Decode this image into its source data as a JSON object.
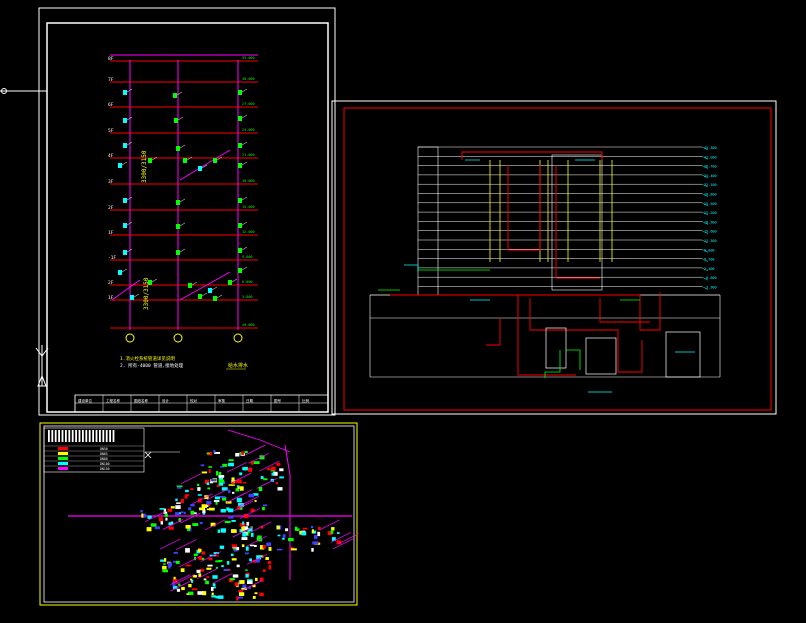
{
  "drawing_left": {
    "floor_labels": [
      "8F",
      "7F",
      "6F",
      "5F",
      "4F",
      "3F",
      "2F",
      "1F",
      "-1F",
      "2F",
      "1F"
    ],
    "elev_labels": [
      "33.000",
      "30.000",
      "27.000",
      "24.000",
      "21.000",
      "18.000",
      "15.000",
      "12.000",
      "9.000",
      "6.000",
      "3.000",
      "±0.000"
    ],
    "dims": [
      "3300/3150",
      "3300/3150"
    ],
    "note_title": "1.消火栓系统管道详见说明",
    "note_line": "2. 所有-4000 管道,接地处理",
    "stamp": "给水排水"
  },
  "drawing_left_titleblock": [
    "建设单位",
    "工程名称",
    "图纸名称",
    "设计",
    "校对",
    "审核",
    "日期",
    "图号",
    "比例"
  ],
  "drawing_right": {
    "level_marks": [
      "45.300",
      "42.000",
      "38.700",
      "35.400",
      "32.100",
      "28.800",
      "25.500",
      "22.200",
      "18.900",
      "15.600",
      "12.300",
      "9.000",
      "5.700",
      "2.400",
      "-0.600",
      "-3.900"
    ]
  },
  "drawing_bottom": {
    "legend_rows": [
      "DN50",
      "DN65",
      "DN80",
      "DN100",
      "DN150"
    ]
  },
  "colors": {
    "background": "#000000",
    "frame": "#ffffff",
    "magenta": "#ff00ff",
    "red": "#ff0000",
    "green": "#00ff00",
    "cyan": "#00ffff",
    "yellow": "#ffff00",
    "blue": "#3f3fff"
  }
}
